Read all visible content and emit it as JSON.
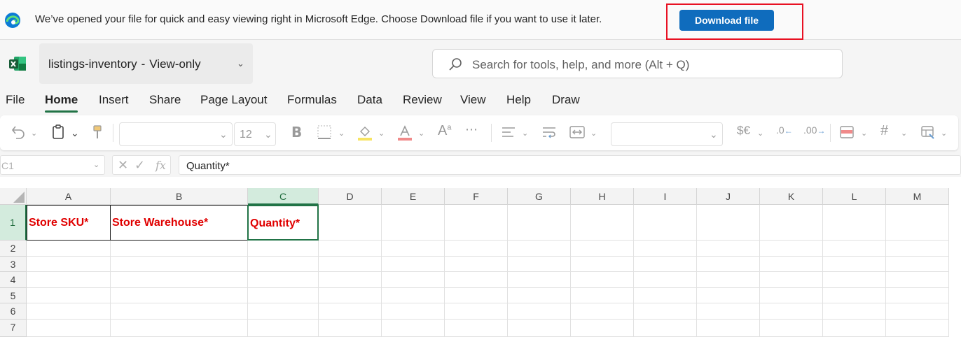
{
  "banner": {
    "message": "We’ve opened your file for quick and easy viewing right in Microsoft Edge. Choose Download file if you want to use it later.",
    "download_label": "Download file",
    "brand_color": "#0f6cbd",
    "highlight_color": "#e81123"
  },
  "titlebar": {
    "file_name": "listings-inventory",
    "separator": "-",
    "mode": "View-only",
    "search_placeholder": "Search for tools, help, and more (Alt + Q)"
  },
  "menu": {
    "tabs": [
      "File",
      "Home",
      "Insert",
      "Share",
      "Page Layout",
      "Formulas",
      "Data",
      "Review",
      "View",
      "Help",
      "Draw"
    ],
    "active": "Home"
  },
  "toolbar": {
    "font_size": "12",
    "icons": [
      "undo-icon",
      "clipboard-icon",
      "format-painter-icon",
      "bold-icon",
      "borders-icon",
      "fill-color-icon",
      "font-color-icon",
      "font-size-icon",
      "more-icon",
      "align-icon",
      "wrap-text-icon",
      "merge-icon",
      "currency-icon",
      "decrease-decimal-icon",
      "increase-decimal-icon",
      "conditional-format-icon",
      "format-table-icon",
      "cell-styles-icon"
    ]
  },
  "formula_bar": {
    "name_box": "C1",
    "fx_label": "fx",
    "formula": "Quantity*"
  },
  "grid": {
    "columns": [
      "A",
      "B",
      "C",
      "D",
      "E",
      "F",
      "G",
      "H",
      "I",
      "J",
      "K",
      "L",
      "M"
    ],
    "rows": [
      "1",
      "2",
      "3",
      "4",
      "5",
      "6",
      "7"
    ],
    "selected_cell": "C1",
    "header_cells": [
      "Store SKU*",
      "Store Warehouse*",
      "Quantity*"
    ],
    "header_text_color": "#e00000",
    "accent_color": "#217346"
  }
}
